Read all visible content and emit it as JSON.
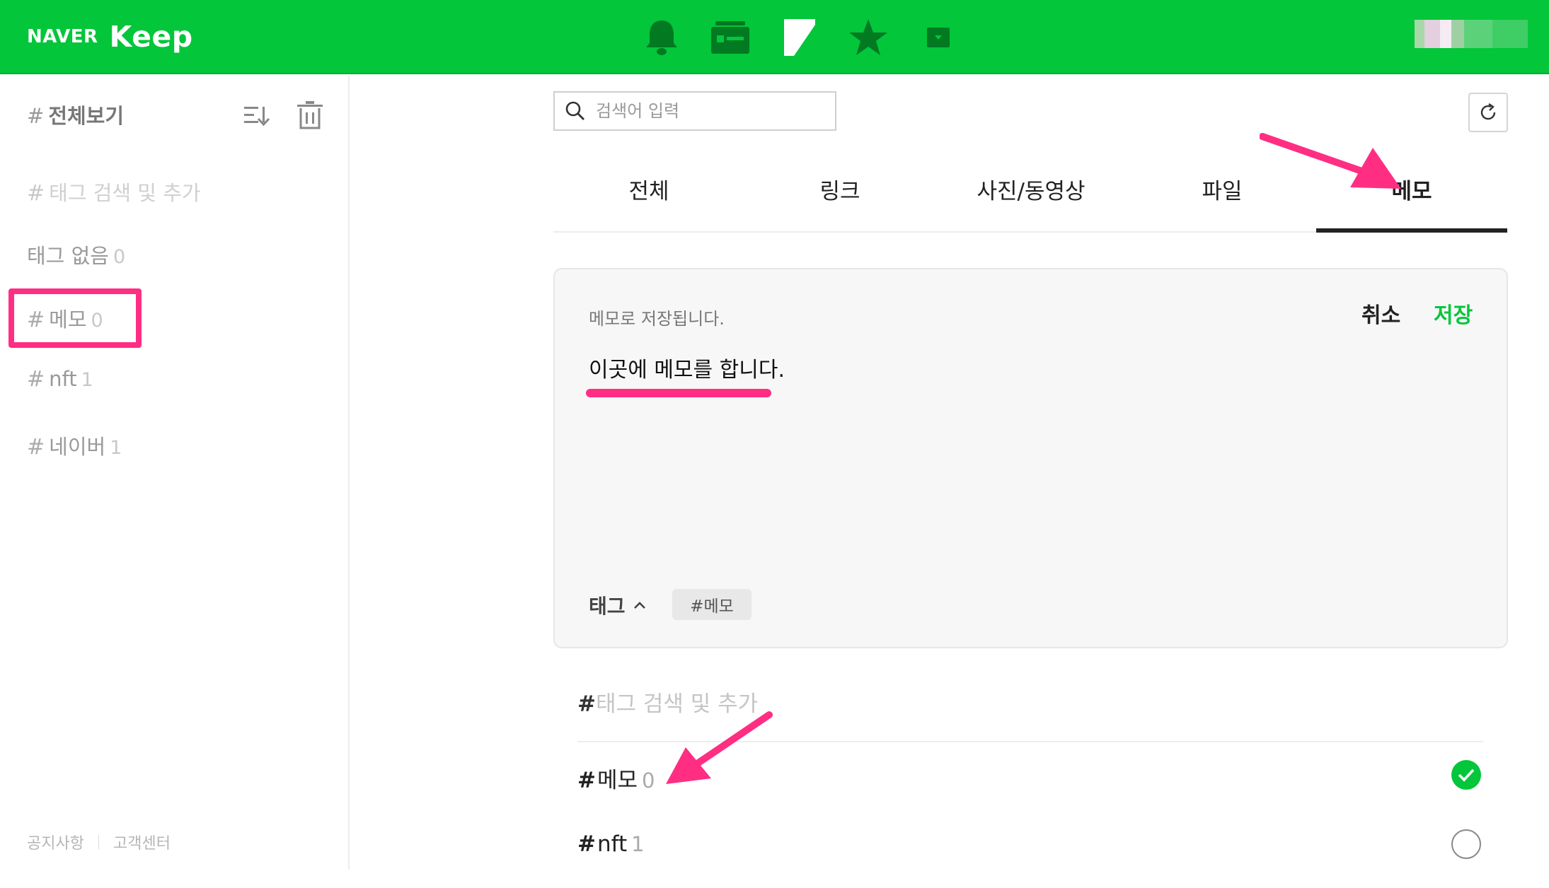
{
  "app": {
    "logo_naver": "NAVER",
    "logo_keep": "Keep"
  },
  "top_icons": [
    "bell-icon",
    "card-list-icon",
    "bookmark-flag-icon",
    "star-icon",
    "archive-icon"
  ],
  "sidebar": {
    "header_hash": "#",
    "header_title": "전체보기",
    "tag_search_hash": "#",
    "tag_search_placeholder": "태그 검색 및 추가",
    "items": [
      {
        "hash": "",
        "label": "태그 없음",
        "count": "0"
      },
      {
        "hash": "#",
        "label": "메모",
        "count": "0"
      },
      {
        "hash": "#",
        "label": "nft",
        "count": "1"
      },
      {
        "hash": "#",
        "label": "네이버",
        "count": "1"
      }
    ],
    "footer_links": [
      "공지사항",
      "고객센터"
    ]
  },
  "search": {
    "placeholder": "검색어 입력"
  },
  "tabs": [
    {
      "label": "전체",
      "active": false
    },
    {
      "label": "링크",
      "active": false
    },
    {
      "label": "사진/동영상",
      "active": false
    },
    {
      "label": "파일",
      "active": false
    },
    {
      "label": "메모",
      "active": true
    }
  ],
  "memo_editor": {
    "hint": "메모로 저장됩니다.",
    "cancel_label": "취소",
    "save_label": "저장",
    "content": "이곳에 메모를 합니다.",
    "tag_toggle_label": "태그",
    "tag_chip": "#메모"
  },
  "tag_picker": {
    "search_hash": "#",
    "search_placeholder": "태그 검색 및 추가",
    "rows": [
      {
        "hash": "#",
        "label": "메모",
        "count": "0",
        "checked": true
      },
      {
        "hash": "#",
        "label": "nft",
        "count": "1",
        "checked": false
      }
    ]
  },
  "colors": {
    "brand_green": "#03c63a",
    "annotation_pink": "#ff2e83"
  }
}
